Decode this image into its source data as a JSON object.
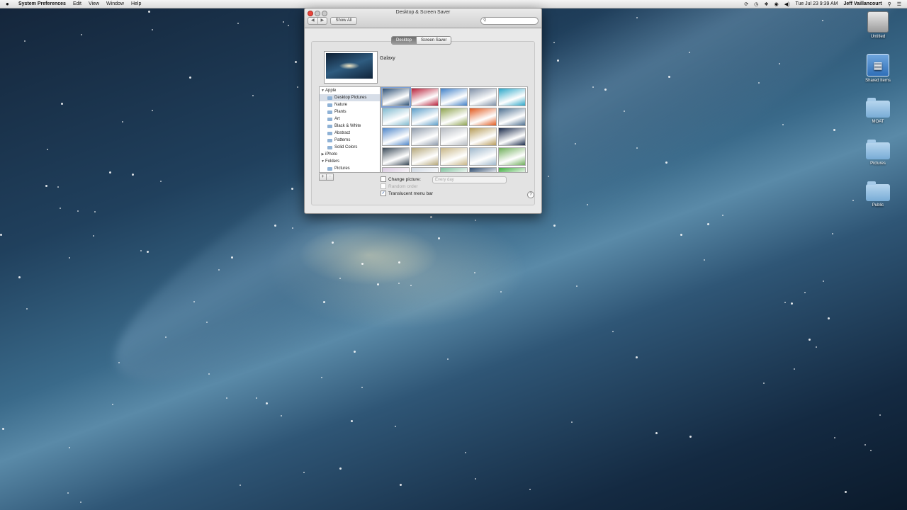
{
  "menubar": {
    "apple": "",
    "items": [
      "System Preferences",
      "Edit",
      "View",
      "Window",
      "Help"
    ],
    "clock": "Tue Jul 23  9:39 AM",
    "user": "Jeff Vaillancourt"
  },
  "window": {
    "title": "Desktop & Screen Saver",
    "show_all": "Show All",
    "search_placeholder": "",
    "tabs": [
      "Desktop",
      "Screen Saver"
    ],
    "current_picture_name": "Galaxy",
    "source_list": [
      {
        "label": "Apple",
        "level": 0,
        "disclosure": "▼"
      },
      {
        "label": "Desktop Pictures",
        "level": 1,
        "selected": true
      },
      {
        "label": "Nature",
        "level": 1
      },
      {
        "label": "Plants",
        "level": 1
      },
      {
        "label": "Art",
        "level": 1
      },
      {
        "label": "Black & White",
        "level": 1
      },
      {
        "label": "Abstract",
        "level": 1
      },
      {
        "label": "Patterns",
        "level": 1
      },
      {
        "label": "Solid Colors",
        "level": 1
      },
      {
        "label": "iPhoto",
        "level": 0,
        "disclosure": "▶"
      },
      {
        "label": "Folders",
        "level": 0,
        "disclosure": "▼"
      },
      {
        "label": "Pictures",
        "level": 1
      }
    ],
    "thumbnail_colors": [
      [
        "#2c4f74",
        "#b8203a",
        "#3f7fc7",
        "#7e8fa6",
        "#2aa6c8"
      ],
      [
        "#7fb9cf",
        "#5b9dc8",
        "#8ea350",
        "#e1591e",
        "#4d6f8f"
      ],
      [
        "#4f86c9",
        "#8f9bab",
        "#b7bcc3",
        "#b69c5a",
        "#1a2a4a"
      ],
      [
        "#3b4a58",
        "#b5a77a",
        "#c8b686",
        "#9fb8cc",
        "#6fae5a"
      ],
      [
        "#d9c9e0",
        "#cfd8e3",
        "#7cc09c",
        "#2d4a6d",
        "#3fae3f"
      ]
    ],
    "options": {
      "change_picture": "Change picture:",
      "change_interval": "Every day",
      "random_order": "Random order",
      "translucent_menu_bar": "Translucent menu bar",
      "translucent_checked": true,
      "add": "+",
      "remove": "−",
      "help": "?"
    }
  },
  "desktop_icons": [
    {
      "label": "Untitled",
      "type": "hard-drive"
    },
    {
      "label": "Shared Items",
      "type": "shared"
    },
    {
      "label": "MOAT",
      "type": "folder"
    },
    {
      "label": "Pictures",
      "type": "folder"
    },
    {
      "label": "Public",
      "type": "folder"
    }
  ]
}
